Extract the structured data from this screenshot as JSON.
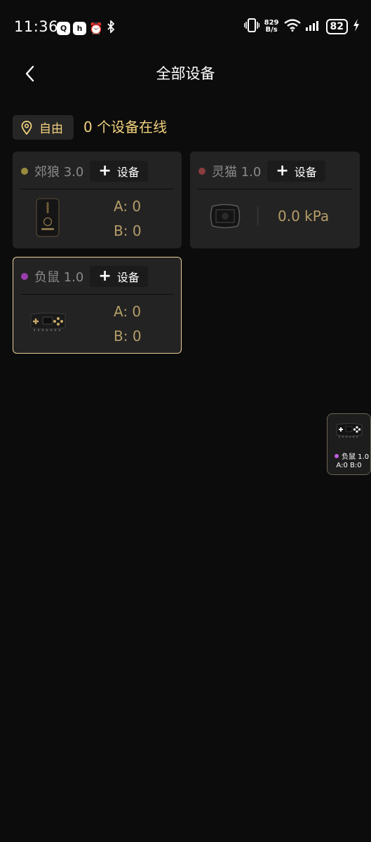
{
  "status_bar": {
    "time": "11:36",
    "net_speed_value": "829",
    "net_speed_unit": "B/s",
    "battery": "82",
    "icons": [
      "app-badge-icon",
      "app-icon",
      "alarm-icon",
      "bluetooth-icon",
      "vibrate-icon",
      "wifi-icon",
      "signal-icon",
      "charging-icon"
    ]
  },
  "header": {
    "title": "全部设备"
  },
  "mode": {
    "label": "自由",
    "icon": "location-pin-icon"
  },
  "online_status": "0 个设备在线",
  "add_label": "设备",
  "devices": [
    {
      "name": "郊狼 3.0",
      "dot_color": "#9a8a3e",
      "a": "A: 0",
      "b": "B: 0",
      "selected": false
    },
    {
      "name": "灵猫 1.0",
      "dot_color": "#8b3d3d",
      "pressure": "0.0 kPa",
      "selected": false
    },
    {
      "name": "负鼠 1.0",
      "dot_color": "#9a3dae",
      "a": "A: 0",
      "b": "B: 0",
      "selected": true
    }
  ],
  "floater": {
    "name": "负鼠 1.0",
    "values": "A:0 B:0",
    "dot_color": "#c25fe0"
  },
  "colors": {
    "background": "#0c0c0c",
    "card": "#232323",
    "accent": "#f3d27f",
    "value": "#b59d69",
    "selected_border": "#e9d198"
  }
}
